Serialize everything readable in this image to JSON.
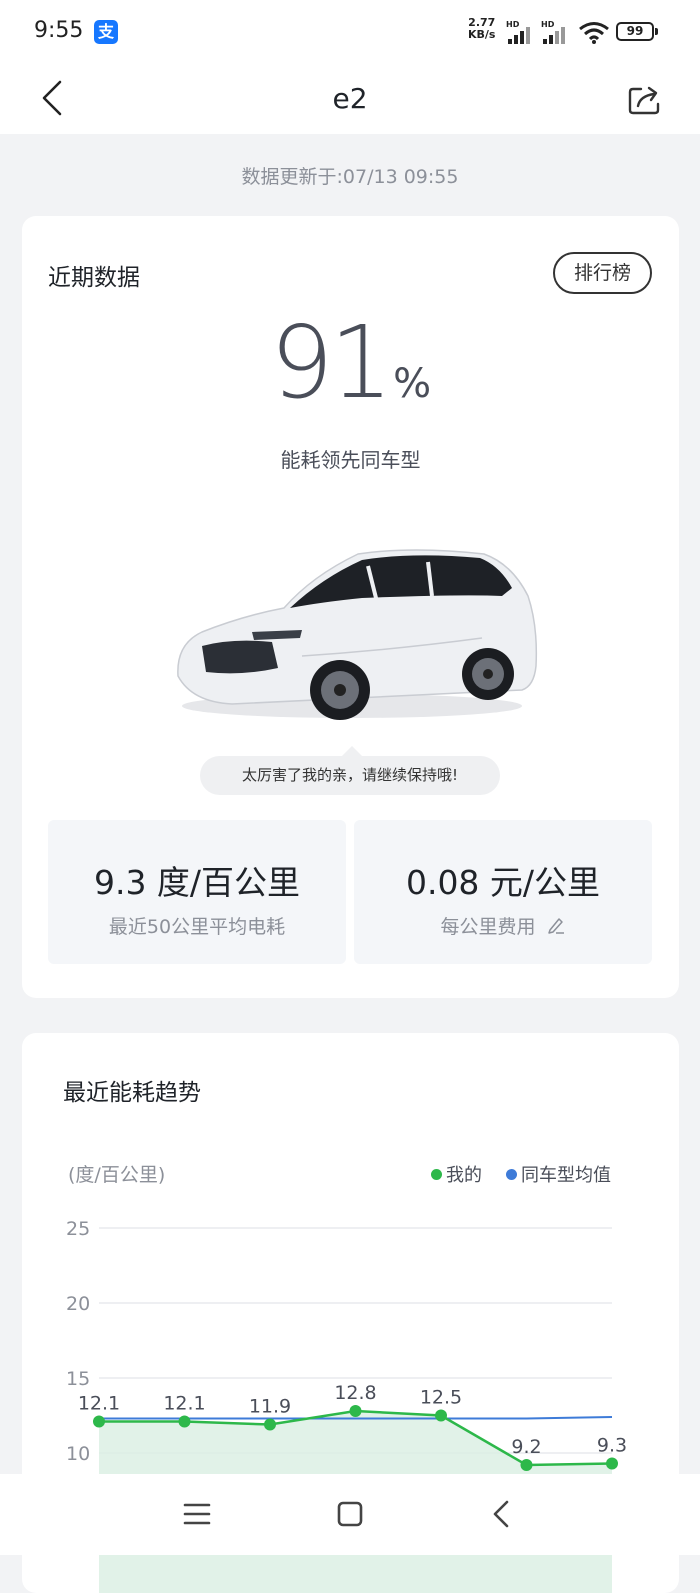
{
  "status_bar": {
    "time": "9:55",
    "app_icon": "alipay-icon",
    "app_icon_glyph": "支",
    "net_speed_value": "2.77",
    "net_speed_unit": "KB/s",
    "signal_label": "HD",
    "battery": "99"
  },
  "header": {
    "title": "e2",
    "back_icon": "chevron-left-icon",
    "share_icon": "share-icon"
  },
  "update_time": "数据更新于:07/13 09:55",
  "recent": {
    "title": "近期数据",
    "rank_button": "排行榜",
    "percent_value": "91",
    "percent_unit": "%",
    "percent_desc": "能耗领先同车型",
    "bubble_text": "太厉害了我的亲，请继续保持哦!",
    "stats": [
      {
        "value": "9.3 度/百公里",
        "label": "最近50公里平均电耗"
      },
      {
        "value": "0.08 元/公里",
        "label": "每公里费用"
      }
    ]
  },
  "trend": {
    "title": "最近能耗趋势"
  },
  "colors": {
    "mine": "#2db84a",
    "average": "#3e7bd8",
    "fill": "#d9efe2"
  },
  "chart_data": {
    "type": "line",
    "ylabel": "(度/百公里)",
    "ylim": [
      10,
      25
    ],
    "yticks": [
      25,
      20,
      15,
      10
    ],
    "grid": true,
    "legend_position": "top-right",
    "x": [
      1,
      2,
      3,
      4,
      5,
      6,
      7
    ],
    "series": [
      {
        "name": "我的",
        "values": [
          12.1,
          12.1,
          11.9,
          12.8,
          12.5,
          9.2,
          9.3
        ],
        "data_labels": [
          "12.1",
          "12.1",
          "11.9",
          "12.8",
          "12.5",
          "9.2",
          "9.3"
        ]
      },
      {
        "name": "同车型均值",
        "values": [
          12.3,
          12.3,
          12.3,
          12.3,
          12.3,
          12.3,
          12.4
        ]
      }
    ]
  },
  "system_nav": {
    "menu_icon": "menu-icon",
    "home_icon": "home-icon",
    "back_icon": "back-icon"
  }
}
